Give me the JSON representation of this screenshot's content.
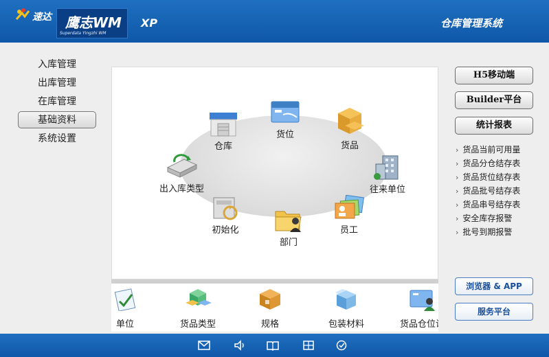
{
  "header": {
    "brand_short": "速达",
    "brand_main": "鹰志WM",
    "brand_sub": "Superdata Yingzhi WM",
    "edition": "XP",
    "system_title": "仓库管理系统"
  },
  "nav": {
    "items": [
      {
        "label": "入库管理"
      },
      {
        "label": "出库管理"
      },
      {
        "label": "在库管理"
      },
      {
        "label": "基础资料",
        "active": true
      },
      {
        "label": "系统设置"
      }
    ]
  },
  "diagram": {
    "nodes": [
      {
        "label": "仓库",
        "icon": "warehouse-icon"
      },
      {
        "label": "货位",
        "icon": "location-icon"
      },
      {
        "label": "货品",
        "icon": "goods-icon"
      },
      {
        "label": "出入库类型",
        "icon": "inout-type-icon"
      },
      {
        "label": "往来单位",
        "icon": "partner-building-icon"
      },
      {
        "label": "初始化",
        "icon": "init-icon"
      },
      {
        "label": "部门",
        "icon": "department-folder-icon"
      },
      {
        "label": "员工",
        "icon": "employee-cards-icon"
      }
    ]
  },
  "strip": {
    "items": [
      {
        "label": "单位",
        "icon": "unit-icon"
      },
      {
        "label": "货品类型",
        "icon": "goods-type-icon"
      },
      {
        "label": "规格",
        "icon": "spec-box-icon"
      },
      {
        "label": "包装材料",
        "icon": "packaging-icon"
      },
      {
        "label": "货品仓位设",
        "icon": "goods-slot-icon"
      }
    ]
  },
  "right": {
    "buttons": [
      {
        "label": "H5移动端"
      },
      {
        "label": "Builder平台"
      },
      {
        "label": "统计报表"
      }
    ],
    "links": [
      {
        "label": "货品当前可用量"
      },
      {
        "label": "货品分仓结存表"
      },
      {
        "label": "货品货位结存表"
      },
      {
        "label": "货品批号结存表"
      },
      {
        "label": "货品串号结存表"
      },
      {
        "label": "安全库存报警"
      },
      {
        "label": "批号到期报警"
      }
    ],
    "service_buttons": [
      {
        "label": "浏览器 & APP"
      },
      {
        "label": "服务平台"
      }
    ]
  },
  "footer": {
    "icons": [
      "mail-icon",
      "speaker-icon",
      "book-icon",
      "windows-icon",
      "check-circle-icon"
    ]
  }
}
